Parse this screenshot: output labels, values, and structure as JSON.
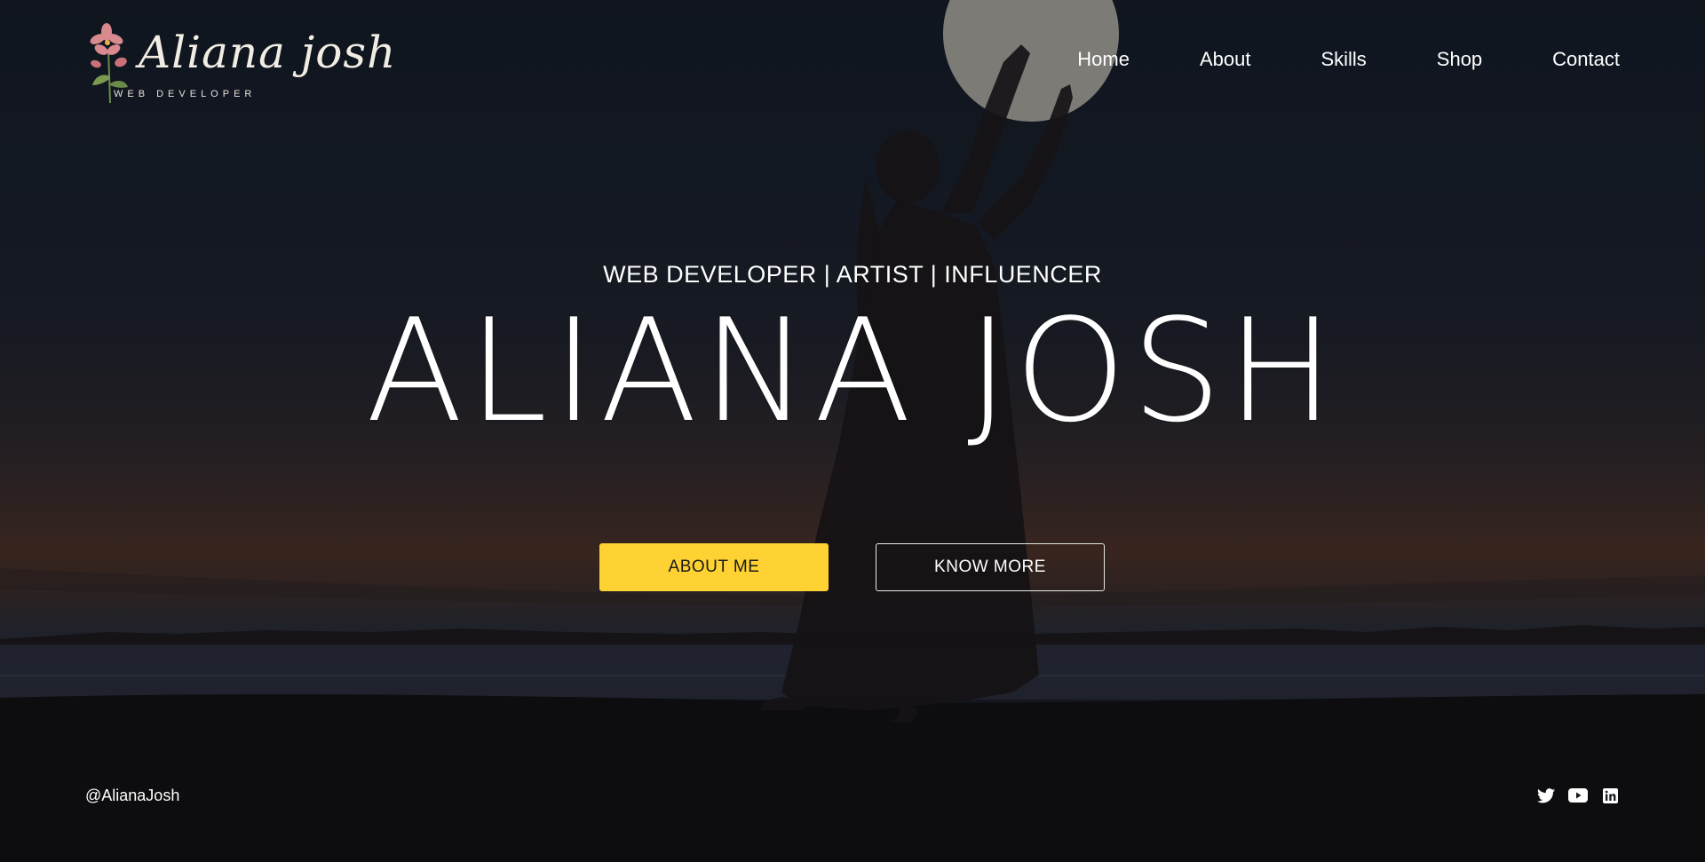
{
  "brand": {
    "logo_script": "Aliana josh",
    "logo_subtitle": "WEB DEVELOPER",
    "logo_icon": "lily-flower-icon"
  },
  "nav": {
    "items": [
      {
        "label": "Home"
      },
      {
        "label": "About"
      },
      {
        "label": "Skills"
      },
      {
        "label": "Shop"
      },
      {
        "label": "Contact"
      }
    ]
  },
  "hero": {
    "tagline": "WEB DEVELOPER | ARTIST | INFLUENCER",
    "name": "ALIANA JOSH",
    "primary_button": "ABOUT ME",
    "secondary_button": "KNOW MORE"
  },
  "footer": {
    "handle": "@AlianaJosh",
    "social_icons": [
      "twitter-icon",
      "youtube-icon",
      "linkedin-icon"
    ]
  },
  "colors": {
    "accent": "#fdd232",
    "text": "#ffffff",
    "background": "#121822"
  }
}
